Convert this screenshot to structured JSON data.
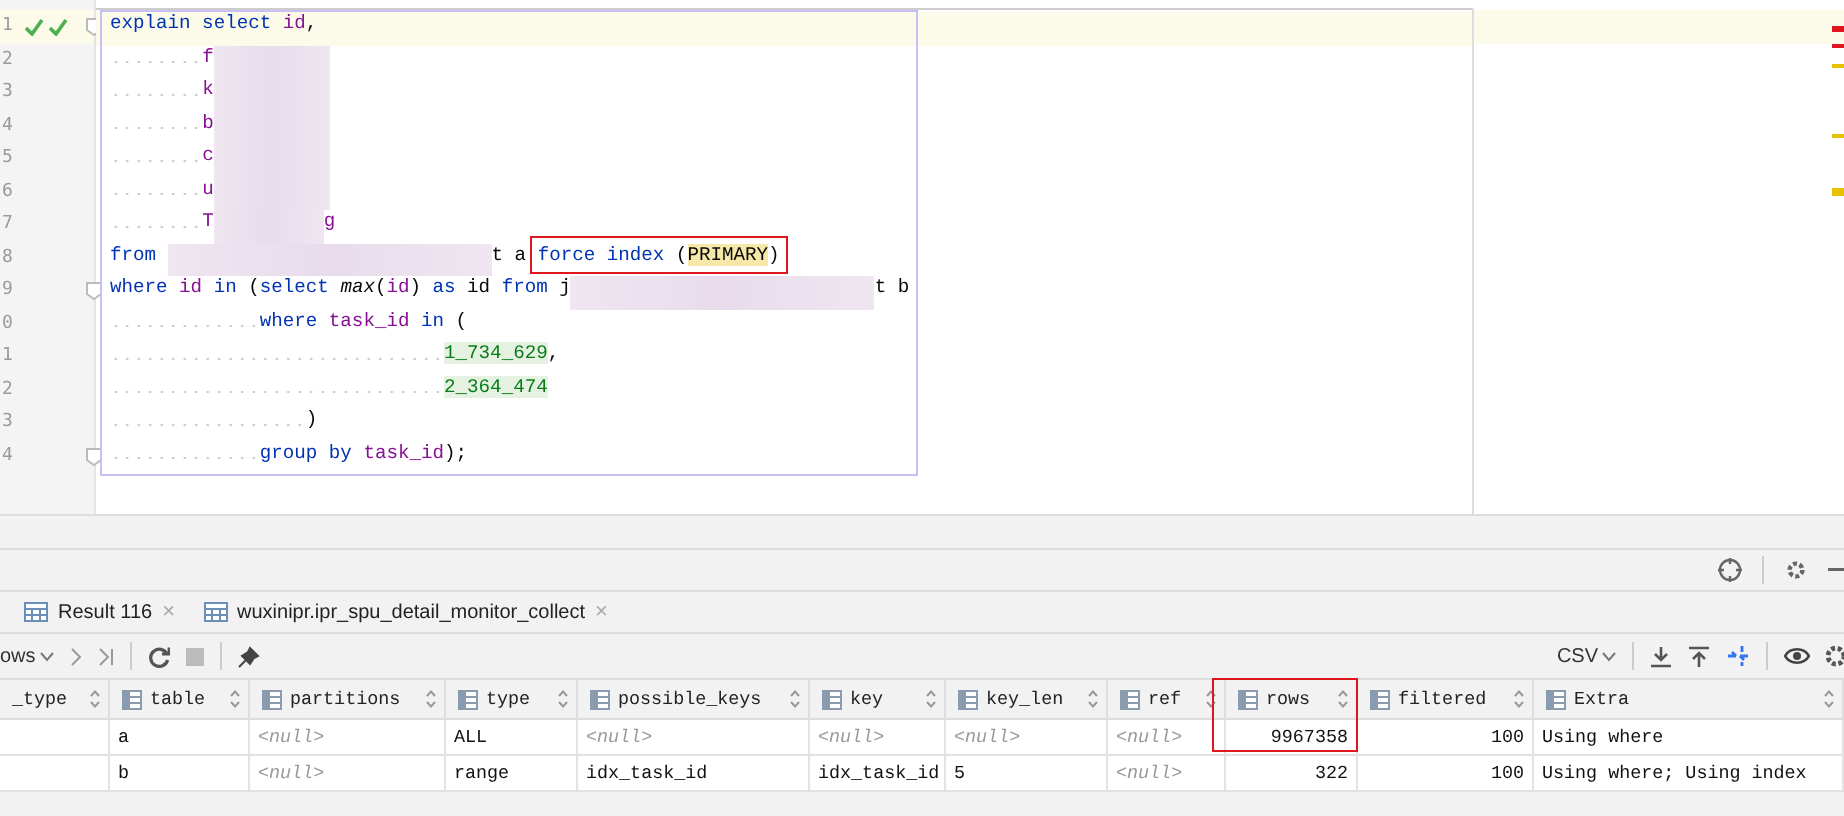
{
  "editor": {
    "lines": [
      {
        "number": "1",
        "current": true,
        "checks": true,
        "fold": true,
        "segments": [
          {
            "kind": "kw",
            "text": "explain select "
          },
          {
            "kind": "id",
            "text": "id"
          },
          {
            "kind": "plain",
            "text": ","
          }
        ]
      },
      {
        "number": "2",
        "current": false,
        "checks": false,
        "fold": false,
        "segments": [
          {
            "kind": "id",
            "text": "f"
          },
          {
            "kind": "blur"
          }
        ]
      },
      {
        "number": "3",
        "current": false,
        "checks": false,
        "fold": false,
        "segments": [
          {
            "kind": "id",
            "text": "k"
          },
          {
            "kind": "blur"
          }
        ]
      },
      {
        "number": "4",
        "current": false,
        "checks": false,
        "fold": false,
        "segments": [
          {
            "kind": "id",
            "text": "b"
          },
          {
            "kind": "blur"
          }
        ]
      },
      {
        "number": "5",
        "current": false,
        "checks": false,
        "fold": false,
        "segments": [
          {
            "kind": "id",
            "text": "c"
          },
          {
            "kind": "blur"
          }
        ]
      },
      {
        "number": "6",
        "current": false,
        "checks": false,
        "fold": false,
        "segments": [
          {
            "kind": "id",
            "text": "u"
          },
          {
            "kind": "blur"
          }
        ]
      },
      {
        "number": "7",
        "current": false,
        "checks": false,
        "fold": false,
        "segments": [
          {
            "kind": "id",
            "text": "T"
          },
          {
            "kind": "blur"
          },
          {
            "kind": "id",
            "text": "g"
          }
        ]
      },
      {
        "number": "8",
        "current": false,
        "checks": false,
        "fold": false,
        "segments": [
          {
            "kind": "kw",
            "text": "from "
          },
          {
            "kind": "blur"
          },
          {
            "kind": "plain",
            "text": "t a "
          },
          {
            "kind": "kw",
            "text": "force index",
            "boxed": true
          },
          {
            "kind": "plain",
            "text": " (",
            "boxed": true
          },
          {
            "kind": "plain",
            "text": "PRIMARY",
            "boxed": true,
            "highlight": true
          },
          {
            "kind": "plain",
            "text": ")",
            "boxed": true
          }
        ]
      },
      {
        "number": "9",
        "current": false,
        "checks": false,
        "fold": true,
        "segments": [
          {
            "kind": "kw",
            "text": "where "
          },
          {
            "kind": "id",
            "text": "id "
          },
          {
            "kind": "kw",
            "text": "in "
          },
          {
            "kind": "plain",
            "text": "("
          },
          {
            "kind": "kw",
            "text": "select "
          },
          {
            "kind": "fn",
            "text": "max"
          },
          {
            "kind": "plain",
            "text": "("
          },
          {
            "kind": "id",
            "text": "id"
          },
          {
            "kind": "plain",
            "text": ") "
          },
          {
            "kind": "kw",
            "text": "as "
          },
          {
            "kind": "plain",
            "text": "id "
          },
          {
            "kind": "kw",
            "text": "from "
          },
          {
            "kind": "plain",
            "text": "j"
          },
          {
            "kind": "blur"
          },
          {
            "kind": "plain",
            "text": "t b"
          }
        ]
      },
      {
        "number": "0",
        "current": false,
        "checks": false,
        "fold": false,
        "segments": [
          {
            "kind": "kw",
            "text": "where "
          },
          {
            "kind": "id",
            "text": "task_id "
          },
          {
            "kind": "kw",
            "text": "in "
          },
          {
            "kind": "plain",
            "text": "("
          }
        ]
      },
      {
        "number": "1",
        "current": false,
        "checks": false,
        "fold": false,
        "segments": [
          {
            "kind": "num",
            "text": "1_734_629"
          },
          {
            "kind": "plain",
            "text": ","
          }
        ]
      },
      {
        "number": "2",
        "current": false,
        "checks": false,
        "fold": false,
        "segments": [
          {
            "kind": "num",
            "text": "2_364_474"
          }
        ]
      },
      {
        "number": "3",
        "current": false,
        "checks": false,
        "fold": false,
        "segments": [
          {
            "kind": "plain",
            "text": ")"
          }
        ]
      },
      {
        "number": "4",
        "current": false,
        "checks": false,
        "fold": true,
        "segments": [
          {
            "kind": "kw",
            "text": "group by "
          },
          {
            "kind": "id",
            "text": "task_id"
          },
          {
            "kind": "plain",
            "text": ");"
          }
        ]
      }
    ]
  },
  "results": {
    "tabs": [
      {
        "label": "Result 116",
        "close": "×"
      },
      {
        "label": "wuxinipr.ipr_spu_detail_monitor_collect",
        "close": "×"
      }
    ],
    "toolbar": {
      "rows_label": "ows",
      "export_format": "CSV"
    },
    "columns": [
      {
        "name": "_type",
        "numeric": false,
        "marked": false
      },
      {
        "name": "table",
        "numeric": false,
        "marked": false
      },
      {
        "name": "partitions",
        "numeric": false,
        "marked": false
      },
      {
        "name": "type",
        "numeric": false,
        "marked": false
      },
      {
        "name": "possible_keys",
        "numeric": false,
        "marked": false
      },
      {
        "name": "key",
        "numeric": false,
        "marked": false
      },
      {
        "name": "key_len",
        "numeric": false,
        "marked": false
      },
      {
        "name": "ref",
        "numeric": false,
        "marked": false
      },
      {
        "name": "rows",
        "numeric": true,
        "marked": true
      },
      {
        "name": "filtered",
        "numeric": true,
        "marked": false
      },
      {
        "name": "Extra",
        "numeric": false,
        "marked": false
      }
    ],
    "rows": [
      [
        {},
        {
          "text": "a"
        },
        {
          "text": "<null>",
          "null": true
        },
        {
          "text": "ALL",
          "null": false
        },
        {
          "text": "<null>",
          "null": true
        },
        {
          "text": "<null>",
          "null": true
        },
        {
          "text": "<null>",
          "null": true
        },
        {
          "text": "<null>",
          "null": true
        },
        {
          "text": "9967358",
          "null": false
        },
        {
          "text": "100",
          "null": false
        },
        {
          "text": "Using where",
          "null": false
        }
      ],
      [
        {},
        {
          "text": "b"
        },
        {
          "text": "<null>",
          "null": true
        },
        {
          "text": "range",
          "null": false
        },
        {
          "text": "idx_task_id",
          "null": false
        },
        {
          "text": "idx_task_id",
          "null": false
        },
        {
          "text": "5",
          "null": false
        },
        {
          "text": "<null>",
          "null": true
        },
        {
          "text": "322",
          "null": false
        },
        {
          "text": "100",
          "null": false
        },
        {
          "text": "Using where; Using index",
          "null": false
        }
      ]
    ]
  }
}
